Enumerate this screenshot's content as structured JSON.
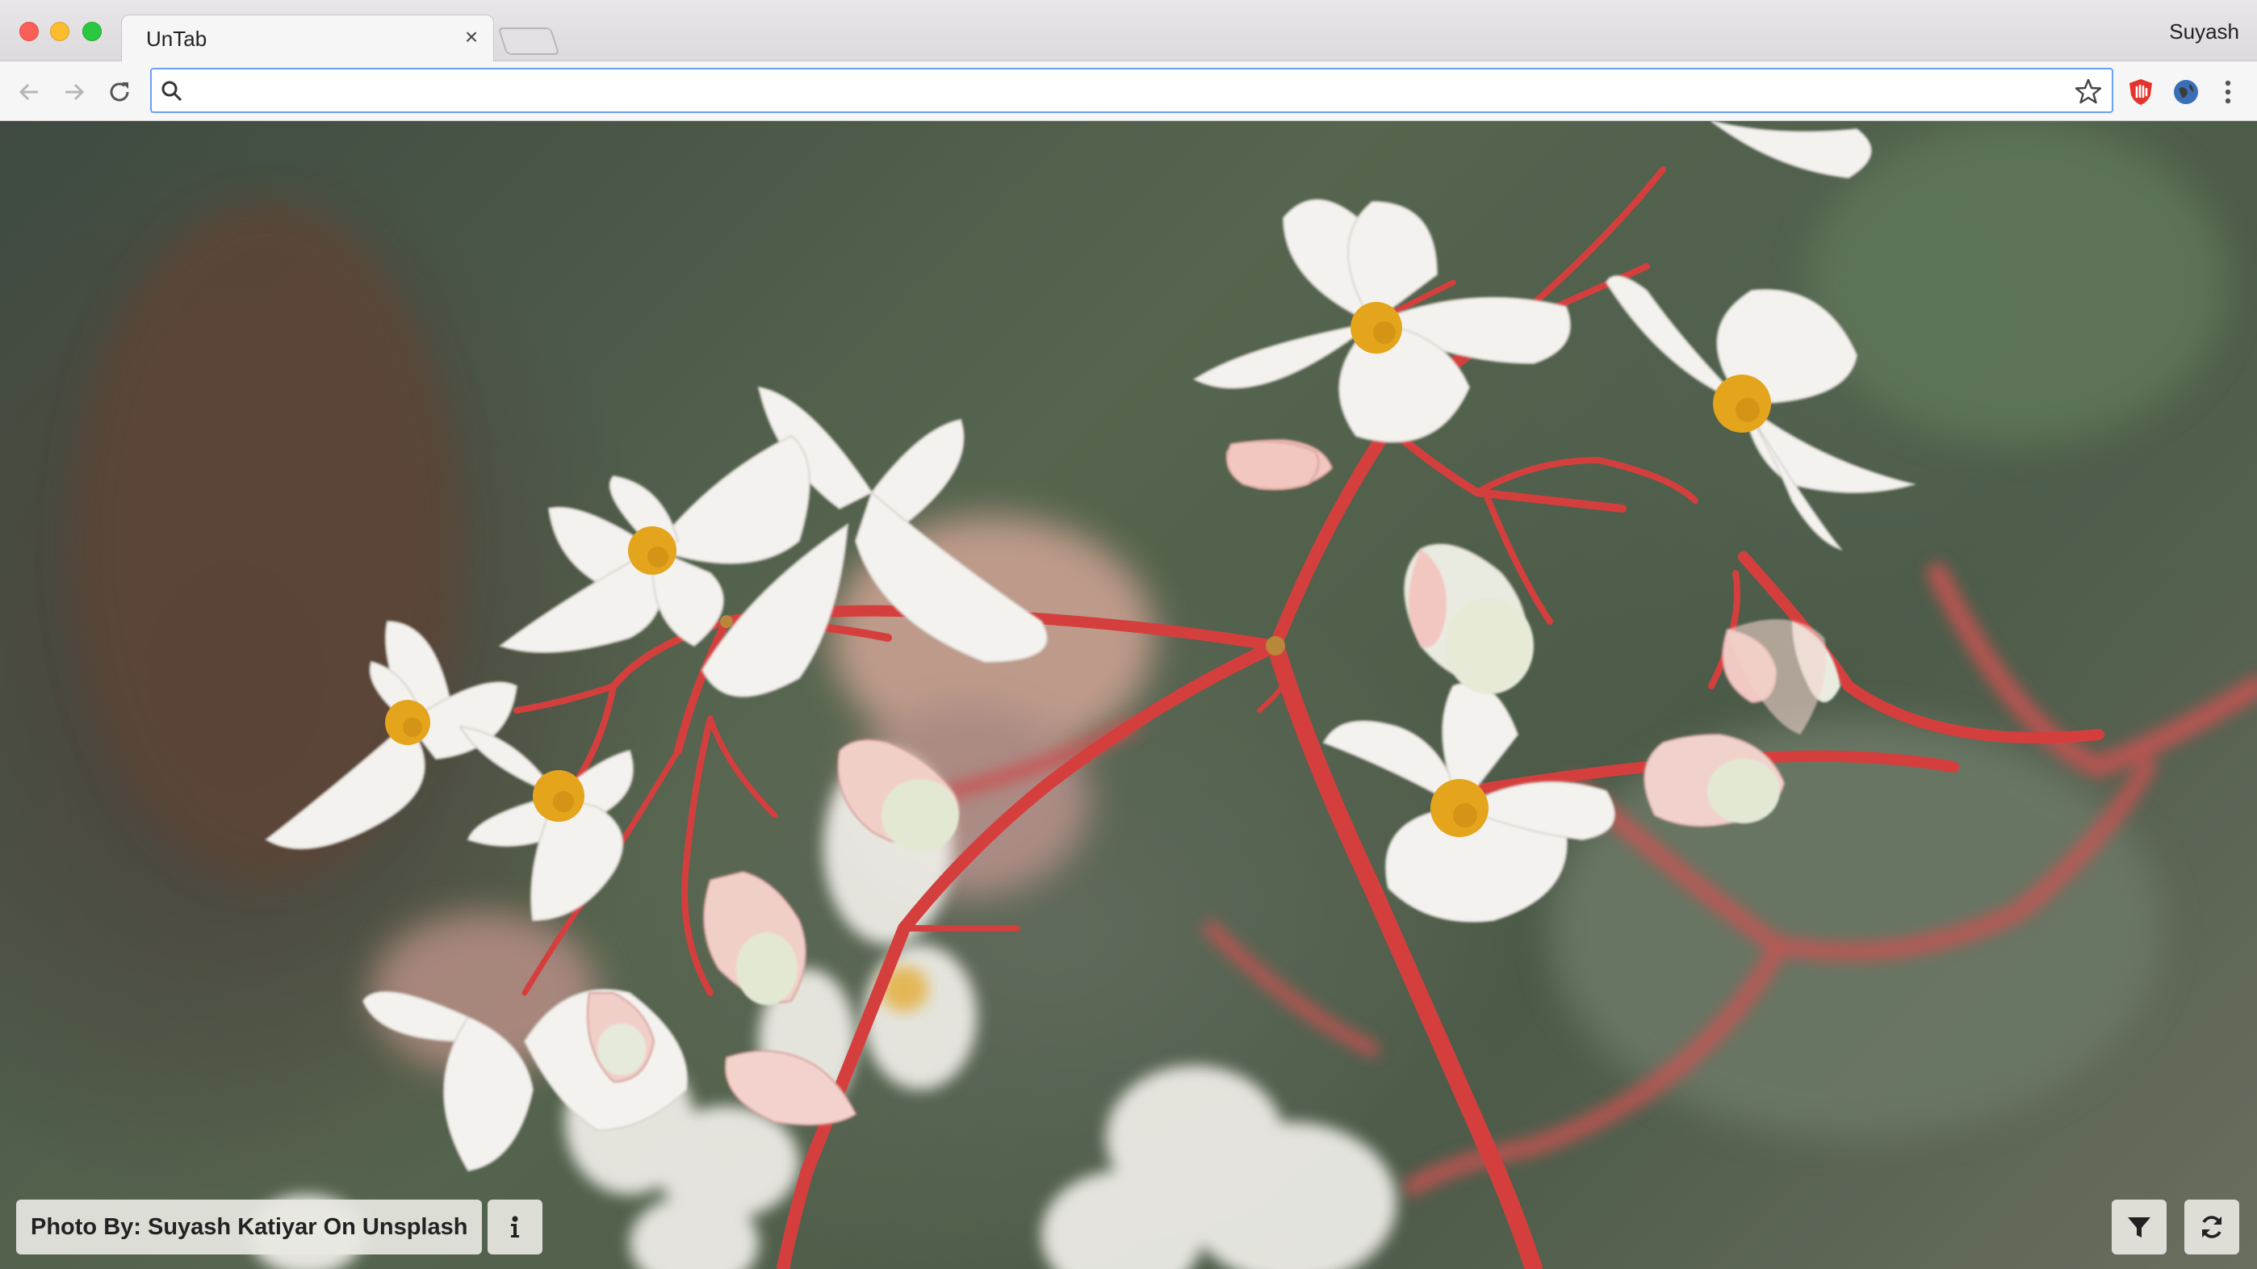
{
  "window": {
    "profile_name": "Suyash"
  },
  "tabs": [
    {
      "title": "UnTab",
      "active": true
    }
  ],
  "omnibox": {
    "value": "",
    "placeholder": ""
  },
  "page": {
    "photo_credit": "Photo By: Suyash Katiyar On Unsplash",
    "buttons": {
      "info_icon": "info-icon",
      "filter_icon": "filter-icon",
      "refresh_icon": "refresh-icon"
    }
  },
  "colors": {
    "accent": "#6c9ef5",
    "stem_red": "#d9413f",
    "petal_white": "#f4f2ee",
    "stamen_yellow": "#e4a41c"
  }
}
